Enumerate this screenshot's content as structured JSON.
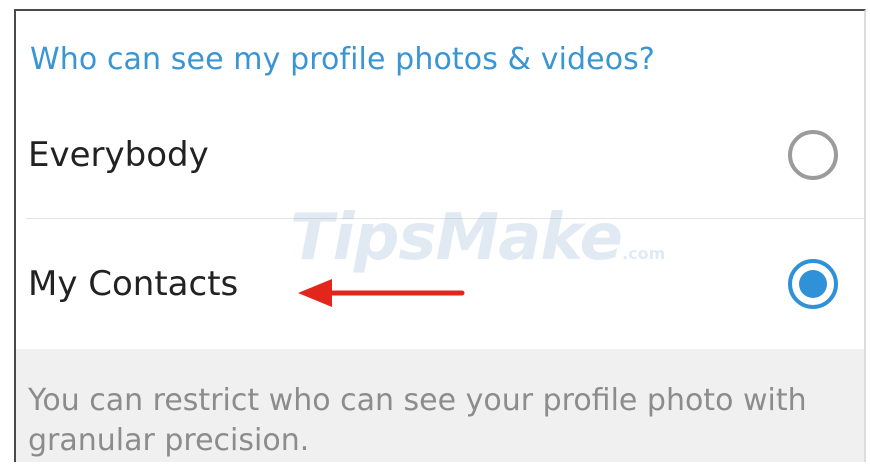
{
  "privacy": {
    "section_title": "Who can see my profile photos & videos?",
    "options": [
      {
        "label": "Everybody",
        "selected": false
      },
      {
        "label": "My Contacts",
        "selected": true
      }
    ],
    "info_text": "You can restrict who can see your profile photo with granular precision."
  },
  "watermark": {
    "brand": "TipsMake",
    "suffix": ".com"
  },
  "colors": {
    "accent": "#3a95d3",
    "radio_selected": "#2f91d8",
    "radio_unselected": "#9b9b9b",
    "annotation_arrow": "#e2261c",
    "info_panel_bg": "#f0f0f0"
  }
}
